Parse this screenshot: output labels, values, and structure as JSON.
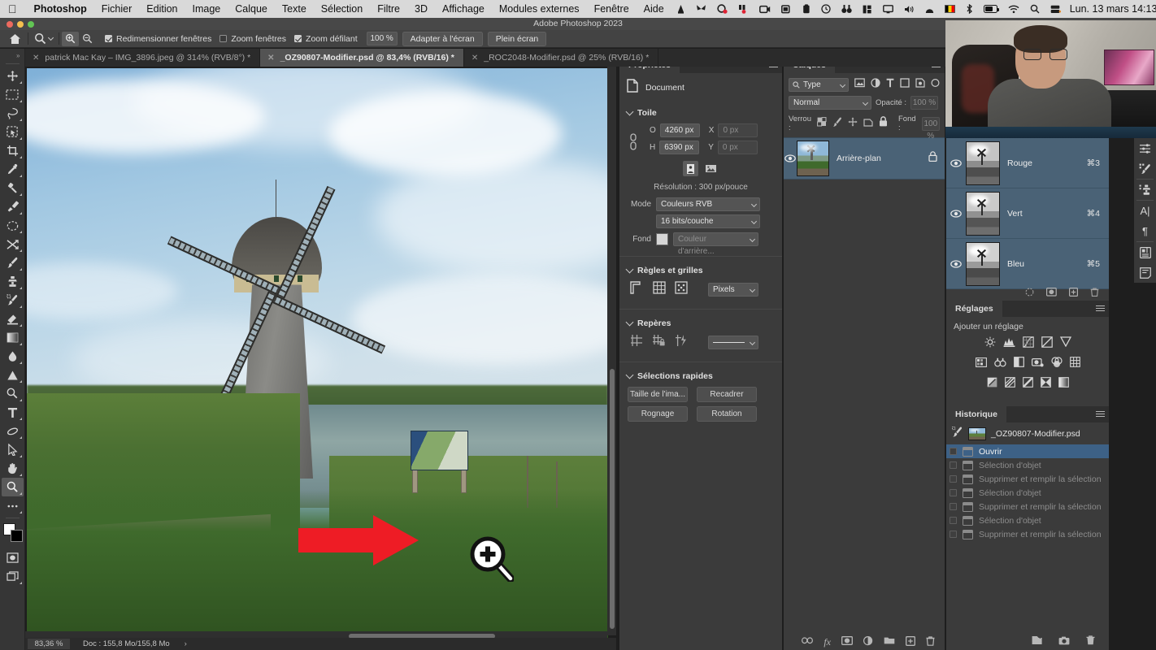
{
  "macmenu": {
    "apple_icon": "apple-logo-icon",
    "items": [
      {
        "label": "Photoshop",
        "bold": true
      },
      {
        "label": "Fichier",
        "bold": false
      },
      {
        "label": "Edition",
        "bold": false
      },
      {
        "label": "Image",
        "bold": false
      },
      {
        "label": "Calque",
        "bold": false
      },
      {
        "label": "Texte",
        "bold": false
      },
      {
        "label": "Sélection",
        "bold": false
      },
      {
        "label": "Filtre",
        "bold": false
      },
      {
        "label": "3D",
        "bold": false
      },
      {
        "label": "Affichage",
        "bold": false
      },
      {
        "label": "Modules externes",
        "bold": false
      },
      {
        "label": "Fenêtre",
        "bold": false
      },
      {
        "label": "Aide",
        "bold": false
      }
    ],
    "status_icons": [
      "vlc-cone-icon",
      "butterfly-icon",
      "record-target-icon",
      "recorder-icon",
      "screen-record-icon",
      "screenshot-icon",
      "clipboard-icon",
      "clock-icon",
      "binoculars-icon",
      "stats-icon",
      "display-icon",
      "volume-icon",
      "arc-icon",
      "belgium-flag-icon",
      "bluetooth-icon",
      "battery-icon",
      "wifi-icon",
      "search-icon",
      "control-center-icon"
    ],
    "clock": "Lun. 13 mars  14:13"
  },
  "window": {
    "title": "Adobe Photoshop 2023"
  },
  "optionsbar": {
    "home_icon": "home-icon",
    "tool_icon": "zoom-tool-icon",
    "zoom_in_icon": "zoom-in-icon",
    "zoom_out_icon": "zoom-out-icon",
    "checkboxes": [
      {
        "label": "Redimensionner fenêtres",
        "checked": true
      },
      {
        "label": "Zoom fenêtres",
        "checked": false
      },
      {
        "label": "Zoom défilant",
        "checked": true
      }
    ],
    "zoom_value": "100 %",
    "buttons": [
      "Adapter à l'écran",
      "Plein écran"
    ]
  },
  "tabs": [
    {
      "label": "patrick Mac Kay – IMG_3896.jpeg @ 314% (RVB/8°) *",
      "active": false
    },
    {
      "label": "_OZ90807-Modifier.psd @ 83,4% (RVB/16) *",
      "active": true
    },
    {
      "label": "_ROC2048-Modifier.psd @ 25% (RVB/16) *",
      "active": false
    }
  ],
  "toolbar": {
    "expand_icon": "expand-toolbar-icon",
    "tools": [
      {
        "name": "move-tool-icon",
        "selected": false
      },
      {
        "name": "rectangular-marquee-tool-icon",
        "selected": false
      },
      {
        "name": "lasso-tool-icon",
        "selected": false
      },
      {
        "name": "object-selection-tool-icon",
        "selected": false
      },
      {
        "name": "crop-tool-icon",
        "selected": false
      },
      {
        "name": "eyedropper-tool-icon",
        "selected": false
      },
      {
        "name": "spot-healing-brush-tool-icon",
        "selected": false
      },
      {
        "name": "brush-tool-icon",
        "selected": false
      },
      {
        "name": "clone-stamp-tool-icon",
        "selected": false
      },
      {
        "name": "history-brush-tool-icon",
        "selected": false
      },
      {
        "name": "eraser-tool-icon",
        "selected": false
      },
      {
        "name": "gradient-tool-icon",
        "selected": false
      },
      {
        "name": "blur-tool-icon",
        "selected": false
      },
      {
        "name": "dodge-tool-icon",
        "selected": false
      },
      {
        "name": "pen-tool-icon",
        "selected": false
      },
      {
        "name": "type-tool-icon",
        "selected": false
      },
      {
        "name": "path-selection-tool-icon",
        "selected": false
      },
      {
        "name": "direct-selection-tool-icon",
        "selected": false
      },
      {
        "name": "hand-tool-icon",
        "selected": false
      },
      {
        "name": "zoom-tool-icon",
        "selected": true
      },
      {
        "name": "edit-toolbar-icon",
        "selected": false
      },
      {
        "name": "quick-mask-icon",
        "selected": false
      },
      {
        "name": "screen-mode-icon",
        "selected": false
      }
    ],
    "foreground_color": "#ffffff",
    "background_color": "#000000"
  },
  "properties": {
    "tab_label": "Propriétés",
    "doc_icon": "document-icon",
    "doc_label": "Document",
    "canvas": {
      "section": "Toile",
      "link_icon": "link-chain-icon",
      "w_label": "O",
      "w_value": "4260 px",
      "h_label": "H",
      "h_value": "6390 px",
      "x_label": "X",
      "x_value": "0 px",
      "y_label": "Y",
      "y_value": "0 px",
      "orientation_portrait_icon": "portrait-orientation-icon",
      "orientation_landscape_icon": "landscape-orientation-icon",
      "resolution": "Résolution : 300 px/pouce",
      "mode_label": "Mode",
      "mode_value": "Couleurs RVB",
      "depth_value": "16 bits/couche",
      "fill_label": "Fond",
      "fill_value": "Couleur d'arrière..."
    },
    "rulers": {
      "section": "Règles et grilles",
      "icons": [
        "rulers-icon",
        "grid-icon",
        "grid-dots-icon"
      ],
      "unit_value": "Pixels"
    },
    "guides": {
      "section": "Repères",
      "icons": [
        "guides-show-icon",
        "guides-lock-icon",
        "smart-guides-icon"
      ],
      "style_value": "———————"
    },
    "quick": {
      "section": "Sélections rapides",
      "buttons": [
        "Taille de l'ima...",
        "Recadrer",
        "Rognage",
        "Rotation"
      ]
    }
  },
  "layers": {
    "tab_label": "Calques",
    "filter_placeholder": "Type",
    "filter_icons": [
      "pixel-filter-icon",
      "adjustment-filter-icon",
      "type-filter-icon",
      "shape-filter-icon",
      "smart-object-filter-icon",
      "filter-toggle-icon"
    ],
    "blend_mode": "Normal",
    "opacity_label": "Opacité :",
    "opacity_value": "100 %",
    "lock_label": "Verrou :",
    "lock_icons": [
      "lock-transparent-icon",
      "lock-image-icon",
      "lock-position-icon",
      "lock-artboard-icon",
      "lock-all-icon"
    ],
    "fill_label": "Fond :",
    "fill_value": "100 %",
    "rows": [
      {
        "name": "Arrière-plan",
        "visible": true,
        "locked": true,
        "selected": true
      }
    ],
    "bottom_icons": [
      "link-layers-icon",
      "layer-style-fx-icon",
      "add-mask-icon",
      "adjustment-layer-icon",
      "new-group-icon",
      "new-layer-icon",
      "delete-layer-icon"
    ]
  },
  "channels": {
    "rows": [
      {
        "name": "Rouge",
        "shortcut": "⌘3",
        "visible": true
      },
      {
        "name": "Vert",
        "shortcut": "⌘4",
        "visible": true
      },
      {
        "name": "Bleu",
        "shortcut": "⌘5",
        "visible": true
      }
    ],
    "bottom_icons": [
      "load-channel-selection-icon",
      "save-selection-as-channel-icon",
      "new-channel-icon",
      "delete-channel-icon"
    ]
  },
  "adjustments": {
    "tab_label": "Réglages",
    "subtitle": "Ajouter un réglage",
    "row1": [
      "brightness-contrast-icon",
      "levels-icon",
      "curves-icon",
      "exposure-icon",
      "vibrance-icon"
    ],
    "row2": [
      "hue-saturation-icon",
      "color-balance-icon",
      "black-white-icon",
      "photo-filter-icon",
      "channel-mixer-icon",
      "color-lookup-icon"
    ],
    "row3": [
      "invert-icon",
      "posterize-icon",
      "threshold-icon",
      "selective-color-icon",
      "gradient-map-icon"
    ]
  },
  "history": {
    "tab_label": "Historique",
    "snapshot_icon": "history-brush-source-icon",
    "snapshot_name": "_OZ90807-Modifier.psd",
    "items": [
      {
        "label": "Ouvrir",
        "current": true
      },
      {
        "label": "Sélection d'objet",
        "current": false
      },
      {
        "label": "Supprimer et remplir la sélection",
        "current": false
      },
      {
        "label": "Sélection d'objet",
        "current": false
      },
      {
        "label": "Supprimer et remplir la sélection",
        "current": false
      },
      {
        "label": "Sélection d'objet",
        "current": false
      },
      {
        "label": "Supprimer et remplir la sélection",
        "current": false
      }
    ],
    "bottom_icons": [
      "create-document-from-state-icon",
      "new-snapshot-icon",
      "delete-state-icon"
    ]
  },
  "rail": {
    "icons": [
      "properties-rail-icon",
      "brush-settings-rail-icon",
      "clone-source-rail-icon",
      "character-rail-icon",
      "paragraph-rail-icon",
      "libraries-rail-icon",
      "notes-rail-icon"
    ]
  },
  "statusbar": {
    "zoom": "83,36 %",
    "doc": "Doc : 155,8 Mo/155,8 Mo",
    "arrow_icon": "chevron-right-icon"
  },
  "canvas_overlays": {
    "red_arrow_icon": "red-arrow-annotation-icon",
    "red_arrow_color": "#ee1c25",
    "zoom_cursor_icon": "zoom-in-cursor-icon"
  },
  "webcam": {
    "overlay_name": "presenter-webcam-overlay"
  },
  "colors": {
    "panel_bg": "#3b3b3b",
    "app_bg": "#1e1e1e",
    "selection_blue": "#4a6276",
    "history_highlight": "#3d6186",
    "menu_bar_bg": "#d9d9d9"
  }
}
